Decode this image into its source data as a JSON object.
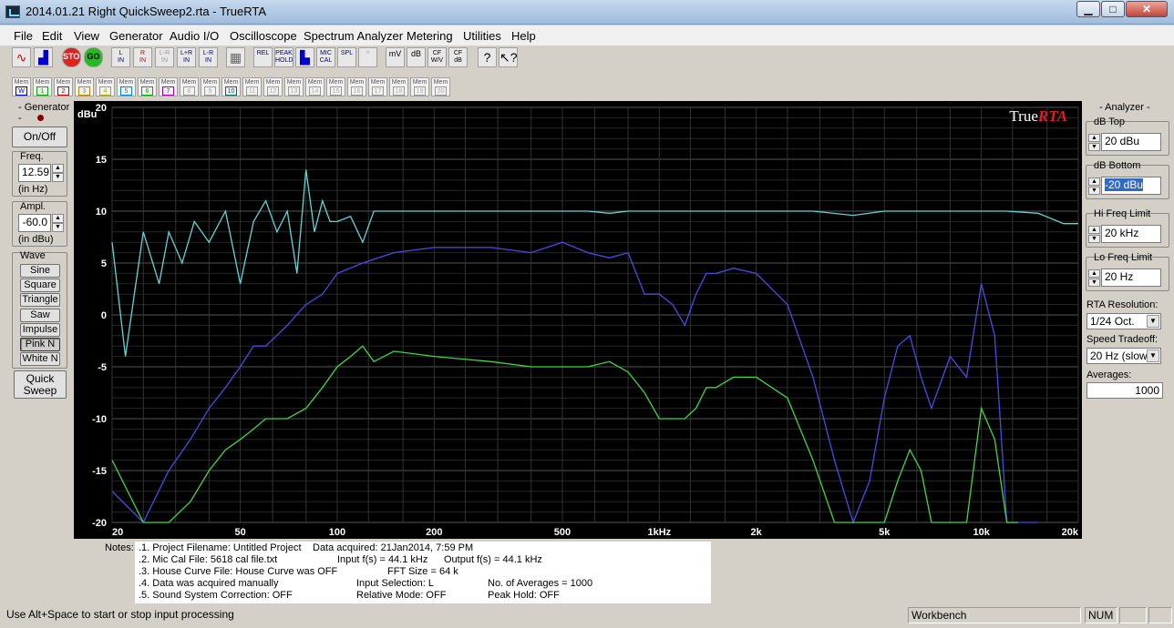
{
  "window": {
    "title": "2014.01.21 Right QuickSweep2.rta - TrueRTA"
  },
  "menu": [
    "File",
    "Edit",
    "View",
    "Generator",
    "Audio I/O",
    "Oscilloscope",
    "Spectrum Analyzer",
    "Metering",
    "Utilities",
    "Help"
  ],
  "toolbar": {
    "buttons": [
      "sine-wave",
      "spectrum",
      "STOP",
      "GO",
      "L IN",
      "R IN",
      "L-R IN",
      "L+R IN",
      "L-R IN",
      "grid",
      "REL",
      "PEAK HOLD",
      "bars",
      "MIC CAL",
      "SPL",
      "x",
      "mV",
      "dB",
      "CF W/V",
      "CF dB",
      "?",
      "?"
    ]
  },
  "memory_buttons": [
    "W",
    "1",
    "2",
    "3",
    "4",
    "5",
    "6",
    "7",
    "8",
    "9",
    "10",
    "11",
    "12",
    "13",
    "14",
    "15",
    "16",
    "17",
    "18",
    "19",
    "20"
  ],
  "memory_label": "Mem",
  "generator": {
    "title": "- Generator -",
    "onoff": "On/Off",
    "freq_label": "Freq.",
    "freq_value": "12.59",
    "freq_unit": "(in Hz)",
    "ampl_label": "Ampl.",
    "ampl_value": "-60.0",
    "ampl_unit": "(in dBu)",
    "wave_label": "Wave",
    "waves": [
      "Sine",
      "Square",
      "Triangle",
      "Saw",
      "Impulse",
      "Pink N",
      "White N"
    ],
    "quick_sweep": "Quick Sweep"
  },
  "analyzer": {
    "title": "- Analyzer -",
    "db_top_label": "dB Top",
    "db_top_value": "20 dBu",
    "db_bottom_label": "dB Bottom",
    "db_bottom_value": "-20 dBu",
    "hi_freq_label": "Hi Freq Limit",
    "hi_freq_value": "20 kHz",
    "lo_freq_label": "Lo Freq Limit",
    "lo_freq_value": "20 Hz",
    "rta_res_label": "RTA Resolution:",
    "rta_res_value": "1/24 Oct.",
    "speed_label": "Speed Tradeoff:",
    "speed_value": "20 Hz (slow)",
    "averages_label": "Averages:",
    "averages_value": "1000"
  },
  "chart_data": {
    "type": "line",
    "ylabel": "dBu",
    "logo_text": "True",
    "logo_accent": "RTA",
    "ylim": [
      -20,
      20
    ],
    "xlim": [
      20,
      20000
    ],
    "x_scale": "log",
    "y_ticks": [
      "20",
      "15",
      "10",
      "5",
      "0",
      "-5",
      "-10",
      "-15",
      "-20"
    ],
    "x_ticks": [
      "20",
      "50",
      "100",
      "200",
      "500",
      "1kHz",
      "2k",
      "5k",
      "10k",
      "20k"
    ],
    "x_tick_values": [
      20,
      50,
      100,
      200,
      500,
      1000,
      2000,
      5000,
      10000,
      20000
    ],
    "grid": true,
    "series": [
      {
        "color": "#5fd6d8",
        "x": [
          20,
          22,
          25,
          28,
          30,
          33,
          36,
          40,
          45,
          50,
          55,
          60,
          65,
          70,
          75,
          80,
          85,
          90,
          95,
          100,
          110,
          120,
          130,
          150,
          175,
          200,
          250,
          300,
          400,
          500,
          600,
          700,
          800,
          1000,
          1500,
          2000,
          3000,
          4000,
          5000,
          7000,
          10000,
          12000,
          15000,
          18000,
          20000
        ],
        "y": [
          7,
          -4,
          8,
          3,
          8,
          5,
          9,
          7,
          10,
          3,
          9,
          11,
          8,
          10,
          4,
          14,
          8,
          11,
          9,
          9,
          9.5,
          7,
          10,
          10,
          10,
          10,
          10,
          10,
          10,
          10,
          10,
          9.8,
          10,
          10,
          10,
          10,
          10,
          9.6,
          10,
          10,
          10,
          10,
          9.8,
          8.8,
          8.8
        ]
      },
      {
        "color": "#4a4ae8",
        "x": [
          20,
          25,
          30,
          35,
          40,
          45,
          50,
          55,
          60,
          70,
          80,
          90,
          100,
          120,
          150,
          200,
          300,
          400,
          500,
          600,
          700,
          800,
          900,
          1000,
          1100,
          1200,
          1300,
          1400,
          1500,
          1700,
          2000,
          2500,
          3000,
          3500,
          4000,
          4500,
          5000,
          5500,
          6000,
          6500,
          7000,
          8000,
          9000,
          10000,
          11000,
          12000,
          13000,
          14000,
          15000
        ],
        "y": [
          -17,
          -20,
          -15,
          -12,
          -9,
          -7,
          -5,
          -3,
          -3,
          -1,
          1,
          2,
          4,
          5,
          6,
          6.5,
          6.5,
          6,
          7,
          6,
          5.5,
          6,
          2,
          2,
          1,
          -1,
          2,
          4,
          4,
          4.5,
          4,
          1,
          -6,
          -14,
          -20,
          -16,
          -8,
          -3,
          -2,
          -6,
          -9,
          -4,
          -6,
          3,
          -2,
          -20,
          -20,
          -20,
          -20
        ]
      },
      {
        "color": "#3fd83f",
        "x": [
          20,
          25,
          30,
          35,
          40,
          45,
          50,
          55,
          60,
          70,
          80,
          90,
          100,
          110,
          120,
          130,
          150,
          200,
          300,
          400,
          500,
          600,
          700,
          800,
          900,
          1000,
          1100,
          1200,
          1300,
          1400,
          1500,
          1700,
          2000,
          2500,
          3000,
          3500,
          4000,
          4500,
          5000,
          5500,
          6000,
          6500,
          7000,
          8000,
          9000,
          10000,
          11000,
          12000,
          13000
        ],
        "y": [
          -14,
          -20,
          -20,
          -18,
          -15,
          -13,
          -12,
          -11,
          -10,
          -10,
          -9,
          -7,
          -5,
          -4,
          -3,
          -4.5,
          -3.5,
          -4,
          -4.5,
          -5,
          -5,
          -5,
          -4.5,
          -5.5,
          -7.5,
          -10,
          -10,
          -10,
          -9,
          -7,
          -7,
          -6,
          -6,
          -8,
          -14,
          -20,
          -20,
          -20,
          -20,
          -16,
          -13,
          -15,
          -20,
          -20,
          -20,
          -9,
          -12,
          -20,
          -20
        ]
      }
    ]
  },
  "notes": {
    "label": "Notes:",
    "lines": [
      ".1. Project Filename: Untitled Project",
      ".2. Mic Cal File: 5618 cal file.txt",
      ".3. House Curve File: House Curve was OFF",
      ".4. Data was acquired manually",
      ".5. Sound System Correction: OFF"
    ],
    "col2": [
      "Data acquired:  21Jan2014, 7:59 PM",
      "Input f(s) = 44.1 kHz",
      "FFT Size = 64 k",
      "Input Selection:  L",
      "Relative Mode:  OFF"
    ],
    "col3": [
      "",
      "Output f(s) = 44.1 kHz",
      "",
      "No. of Averages = 1000",
      "Peak Hold: OFF"
    ]
  },
  "status": {
    "hint": "Use Alt+Space to start or stop input processing",
    "workbench": "Workbench",
    "num": "NUM"
  }
}
